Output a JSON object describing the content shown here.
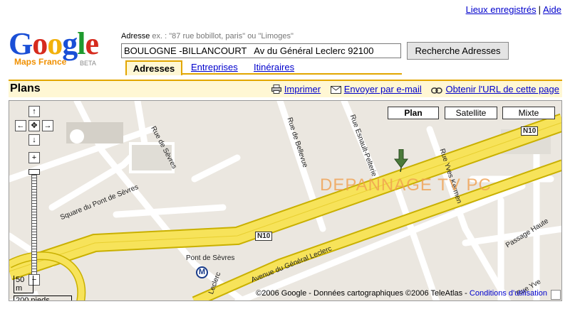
{
  "header": {
    "links": [
      "Lieux enregistrés",
      "Aide"
    ]
  },
  "logo": {
    "word": [
      "G",
      "o",
      "o",
      "g",
      "l",
      "e"
    ],
    "product": "Maps France",
    "badge": "BETA"
  },
  "search": {
    "label": "Adresse",
    "example": "ex. : \"87 rue bobillot, paris\" ou \"Limoges\"",
    "value": "BOULOGNE -BILLANCOURT   Av du Général Leclerc 92100",
    "button": "Recherche Adresses"
  },
  "tabs": [
    {
      "label": "Adresses",
      "active": true
    },
    {
      "label": "Entreprises",
      "active": false
    },
    {
      "label": "Itinéraires",
      "active": false
    }
  ],
  "plans": {
    "title": "Plans",
    "actions": [
      {
        "label": "Imprimer",
        "icon": "printer-icon"
      },
      {
        "label": "Envoyer par e-mail",
        "icon": "email-icon"
      },
      {
        "label": "Obtenir l'URL de cette page",
        "icon": "link-icon"
      }
    ]
  },
  "map": {
    "types": [
      {
        "label": "Plan",
        "active": true
      },
      {
        "label": "Satellite",
        "active": false
      },
      {
        "label": "Mixte",
        "active": false
      }
    ],
    "streets": [
      "Rue de Sèvres",
      "Rue de Bellevue",
      "Rue Esnault-Pelterie",
      "Square du Pont de Sèvres",
      "Rue Yves Kermen",
      "Passage Haute",
      "Avenue du Général Leclerc",
      "Pont de Sèvres",
      "Rue Yve",
      "Leclerc",
      "N10",
      "N10"
    ],
    "metro": "M",
    "scale_m": "50 m",
    "scale_ft": "200 pieds",
    "watermark": "DEPANNAGE TV PC",
    "copyright": "©2006 Google - Données cartographiques ©2006 TeleAtlas -",
    "terms": "Conditions d'utilisation"
  },
  "colors": {
    "tab_border": "#e2a600",
    "highway": "#f7e35a",
    "road": "#ffffff",
    "map_bg": "#ebe7e0",
    "watermark": "#f0a050"
  }
}
